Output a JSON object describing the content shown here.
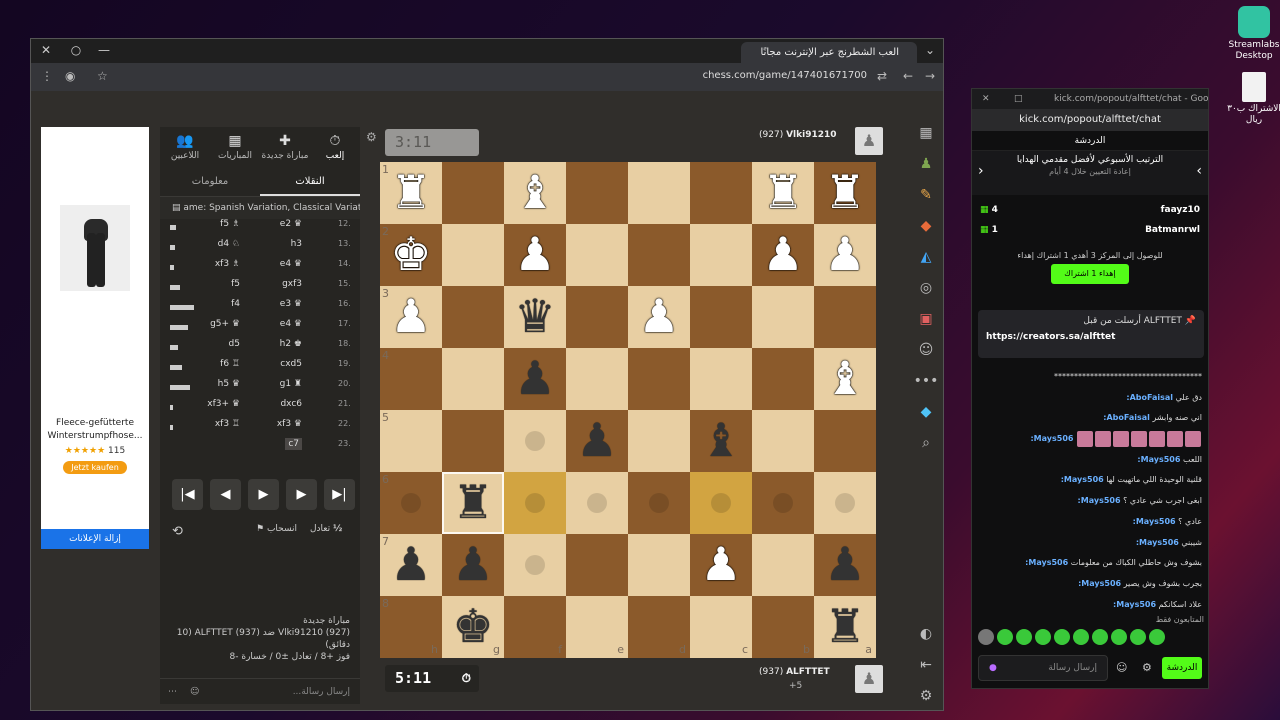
{
  "desktop": {
    "icons": [
      {
        "label": "Streamlabs Desktop"
      },
      {
        "label": "الاشتراك ب٣٠ ريال"
      }
    ]
  },
  "browser": {
    "tab_title": "العب الشطرنج عبر الإنترنت مجانًا",
    "url": "chess.com/game/147401671700"
  },
  "ad": {
    "product": "Fleece-gefütterte Winterstrumpfhose...",
    "rating": "115",
    "stars": "★★★★★",
    "cta": "Jetzt kaufen",
    "remove": "إزالة الإعلانات"
  },
  "panel": {
    "tabs": [
      {
        "icon": "⏱",
        "label": "إلعب"
      },
      {
        "icon": "✚",
        "label": "مباراة جديدة"
      },
      {
        "icon": "▦",
        "label": "المباريات"
      },
      {
        "icon": "👥",
        "label": "اللاعبين"
      }
    ],
    "subtabs": [
      "النقلات",
      "معلومات"
    ],
    "opening": "ame: Spanish Variation, Classical Variation",
    "moves": [
      {
        "n": "12.",
        "w": "e2 ♛",
        "b": "f5 ♗",
        "bar": 6
      },
      {
        "n": "13.",
        "w": "h3",
        "b": "d4 ♘",
        "bar": 5
      },
      {
        "n": "14.",
        "w": "e4 ♛",
        "b": "xf3 ♗",
        "bar": 4
      },
      {
        "n": "15.",
        "w": "gxf3",
        "b": "f5",
        "bar": 10
      },
      {
        "n": "16.",
        "w": "e3 ♛",
        "b": "f4",
        "bar": 24
      },
      {
        "n": "17.",
        "w": "e4 ♛",
        "b": "g5+ ♛",
        "bar": 18
      },
      {
        "n": "18.",
        "w": "h2 ♚",
        "b": "d5",
        "bar": 8
      },
      {
        "n": "19.",
        "w": "cxd5",
        "b": "f6 ♖",
        "bar": 12
      },
      {
        "n": "20.",
        "w": "g1 ♜",
        "b": "h5 ♛",
        "bar": 20
      },
      {
        "n": "21.",
        "w": "dxc6",
        "b": "xf3+ ♛",
        "bar": 3
      },
      {
        "n": "22.",
        "w": "xf3 ♛",
        "b": "xf3 ♖",
        "bar": 3
      },
      {
        "n": "23.",
        "w": "c7",
        "b": "",
        "bar": 0
      }
    ],
    "controls": [
      "|◀",
      "◀",
      "▶",
      "▶",
      "▶|"
    ],
    "draw": "تعادل",
    "resign": "انسحاب",
    "half": "½",
    "footer_title": "مباراة جديدة",
    "footer_line1": "Vlki91210 (927) ضد ALFTTET (937) (10 دقائق)",
    "footer_line2": "فوز +8 / تعادل ±0 / خسارة -8",
    "chat_placeholder": "إرسال رسالة..."
  },
  "game": {
    "top_clock": "3:11",
    "bottom_clock": "5:11",
    "top_player": "Vlki91210",
    "top_rating": "(927)",
    "bottom_player": "ALFTTET",
    "bottom_rating": "(937)",
    "bottom_extra": "+5"
  },
  "board": {
    "pieces": [
      {
        "sq": "h1",
        "p": "♜",
        "c": "w"
      },
      {
        "sq": "f1",
        "p": "♝",
        "c": "w"
      },
      {
        "sq": "b1",
        "p": "♜",
        "c": "w"
      },
      {
        "sq": "a1",
        "p": "♜",
        "c": "w"
      },
      {
        "sq": "h2",
        "p": "♚",
        "c": "w"
      },
      {
        "sq": "f2",
        "p": "♟",
        "c": "w"
      },
      {
        "sq": "b2",
        "p": "♟",
        "c": "w"
      },
      {
        "sq": "a2",
        "p": "♟",
        "c": "w"
      },
      {
        "sq": "h3",
        "p": "♟",
        "c": "w"
      },
      {
        "sq": "f3",
        "p": "♛",
        "c": "b"
      },
      {
        "sq": "d3",
        "p": "♟",
        "c": "w"
      },
      {
        "sq": "a4",
        "p": "♝",
        "c": "w"
      },
      {
        "sq": "f4",
        "p": "♟",
        "c": "b"
      },
      {
        "sq": "e5",
        "p": "♟",
        "c": "b"
      },
      {
        "sq": "c5",
        "p": "♝",
        "c": "b"
      },
      {
        "sq": "g6",
        "p": "♜",
        "c": "b"
      },
      {
        "sq": "h7",
        "p": "♟",
        "c": "b"
      },
      {
        "sq": "g7",
        "p": "♟",
        "c": "b"
      },
      {
        "sq": "c7",
        "p": "♟",
        "c": "w"
      },
      {
        "sq": "a7",
        "p": "♟",
        "c": "b"
      },
      {
        "sq": "g8",
        "p": "♚",
        "c": "b"
      },
      {
        "sq": "a8",
        "p": "♜",
        "c": "b"
      }
    ],
    "highlights": [
      "f6",
      "c6"
    ],
    "selected": "g6",
    "hints": [
      "f5",
      "h6",
      "f6",
      "e6",
      "d6",
      "c6",
      "b6",
      "a6",
      "g7",
      "f7",
      "c7"
    ],
    "light": "#e8cfa3",
    "dark": "#8b5a2b",
    "hl": "#d2a441"
  },
  "kick": {
    "title": "kick.com/popout/alfttet/chat - Goo...",
    "url": "kick.com/popout/alfttet/chat",
    "header": "الدردشة",
    "card_title": "الترتيب الأسبوعي لأفضل مقدمي الهدايا",
    "card_sub": "إعادة التعيين خلال 4 أيام",
    "ranks": [
      {
        "name": "faayz10",
        "count": "4"
      },
      {
        "name": "Batmanrwl",
        "count": "1"
      }
    ],
    "note": "للوصول إلى المركز 3 أهدي 1 اشتراك إهداء",
    "gift_btn": "إهداء 1 اشتراك",
    "pin_by": "ALFTTET أرسلت من قبل",
    "pin_link": "https://creators.sa/alfttet",
    "messages": [
      {
        "u": "",
        "t": "*************************************"
      },
      {
        "u": "AboFaisal:",
        "t": "دق علي"
      },
      {
        "u": "AboFaisal:",
        "t": "اني صنه وابشر"
      },
      {
        "u": "Mays506:",
        "t": "",
        "emotes": 7
      },
      {
        "u": "Mays506:",
        "t": "اللعب"
      },
      {
        "u": "Mays506:",
        "t": "قلنية الوحيدة اللي ماتهيت لها"
      },
      {
        "u": "Mays506:",
        "t": "ابغى اجرب شي عادي ؟"
      },
      {
        "u": "Mays506:",
        "t": "عادي ؟"
      },
      {
        "u": "Mays506:",
        "t": "شيبني"
      },
      {
        "u": "Mays506:",
        "t": "بشوف وش حاطلي الكباك من معلومات"
      },
      {
        "u": "Mays506:",
        "t": "بجرب بشوف وش يصير"
      },
      {
        "u": "Mays506:",
        "t": "علاد اسكانكم"
      }
    ],
    "viewers": "المتابعون فقط",
    "input_placeholder": "إرسال رسالة",
    "send": "الدردشة"
  }
}
